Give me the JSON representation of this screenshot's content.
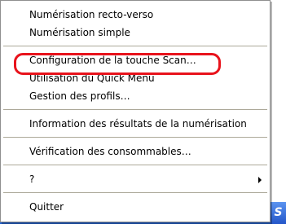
{
  "menu": {
    "items": [
      {
        "label": "Numérisation recto-verso"
      },
      {
        "label": "Numérisation simple"
      },
      {
        "label": "Configuration de la touche Scan…"
      },
      {
        "label": "Utilisation du Quick Menu"
      },
      {
        "label": "Gestion des profils…"
      },
      {
        "label": "Information des résultats de la numérisation"
      },
      {
        "label": "Vérification des consommables…"
      },
      {
        "label": "?"
      },
      {
        "label": "Quitter"
      }
    ],
    "submenu_arrow_icon": "chevron-right-icon"
  },
  "tray": {
    "icon_glyph": "S",
    "icon_name": "scanner-tray-icon"
  },
  "highlight": {
    "color": "#e8131c",
    "target": "Configuration de la touche Scan…"
  },
  "colors": {
    "menu_border": "#8f8f8f",
    "separator": "#aca899",
    "taskbar": "#2a62d6"
  }
}
